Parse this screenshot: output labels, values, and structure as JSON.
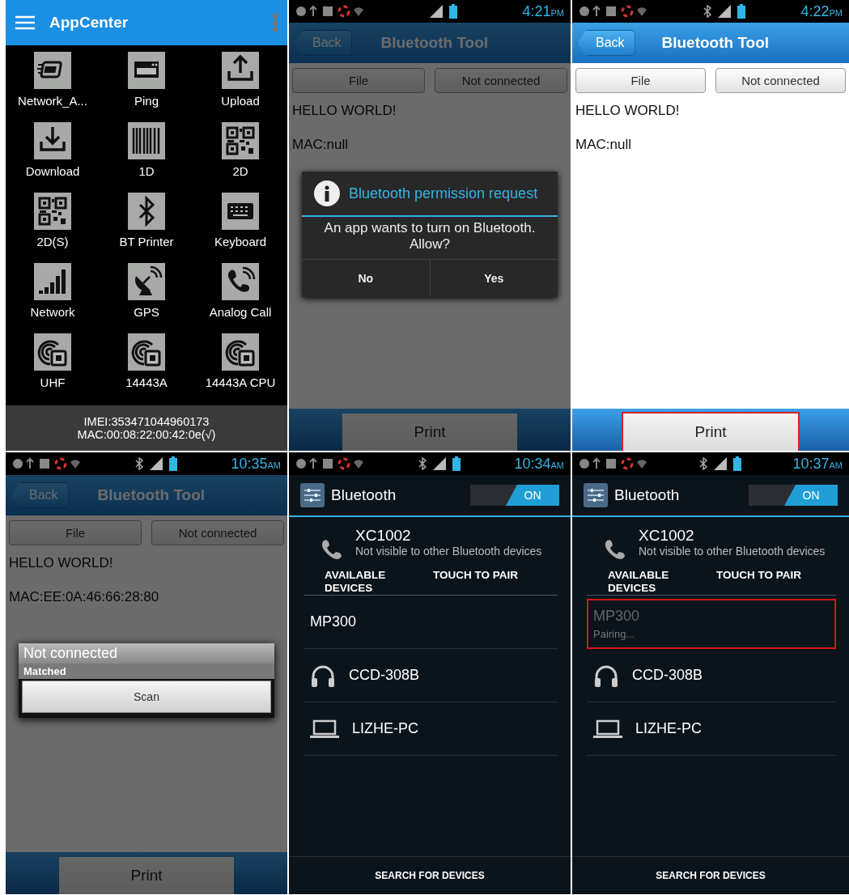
{
  "screens": [
    {
      "kind": "appcenter",
      "title": "AppCenter",
      "apps": [
        {
          "label": "Network_A...",
          "kind": "adapter"
        },
        {
          "label": "Ping",
          "kind": "window"
        },
        {
          "label": "Upload",
          "kind": "upload"
        },
        {
          "label": "Download",
          "kind": "download"
        },
        {
          "label": "1D",
          "kind": "barcode"
        },
        {
          "label": "2D",
          "kind": "qr"
        },
        {
          "label": "2D(S)",
          "kind": "qr"
        },
        {
          "label": "BT Printer",
          "kind": "bluetooth"
        },
        {
          "label": "Keyboard",
          "kind": "keyboard"
        },
        {
          "label": "Network",
          "kind": "signal"
        },
        {
          "label": "GPS",
          "kind": "dish"
        },
        {
          "label": "Analog Call",
          "kind": "call"
        },
        {
          "label": "UHF",
          "kind": "rfid"
        },
        {
          "label": "14443A",
          "kind": "rfid"
        },
        {
          "label": "14443A CPU",
          "kind": "rfid"
        }
      ],
      "footer": [
        "IMEI:353471044960173",
        "MAC:00:08:22:00:42:0e(√)"
      ]
    },
    {
      "kind": "tool",
      "status": {
        "time": "4:21",
        "period": "PM",
        "bluetooth": false
      },
      "back": "Back",
      "title": "Bluetooth Tool",
      "file": "File",
      "connection": "Not connected",
      "lines": [
        "HELLO WORLD!",
        "MAC:null"
      ],
      "print": {
        "label": "Print",
        "highlighted": false
      },
      "dialog": {
        "kind": "permission",
        "title": "Bluetooth permission request",
        "message": "An app wants to turn on Bluetooth. Allow?",
        "buttons": [
          "No",
          "Yes"
        ]
      }
    },
    {
      "kind": "tool",
      "status": {
        "time": "4:22",
        "period": "PM",
        "bluetooth": true
      },
      "back": "Back",
      "title": "Bluetooth Tool",
      "file": "File",
      "connection": "Not connected",
      "lines": [
        "HELLO WORLD!",
        "MAC:null"
      ],
      "print": {
        "label": "Print",
        "highlighted": true
      }
    },
    {
      "kind": "tool",
      "status": {
        "time": "10:35",
        "period": "AM",
        "bluetooth": true
      },
      "back": "Back",
      "title": "Bluetooth Tool",
      "file": "File",
      "connection": "Not connected",
      "lines": [
        "HELLO WORLD!",
        "MAC:EE:0A:46:66:28:80"
      ],
      "print": {
        "label": "Print",
        "highlighted": false
      },
      "dialog": {
        "kind": "menu",
        "title": "Not connected",
        "items": [
          "Matched"
        ],
        "button": "Scan"
      }
    },
    {
      "kind": "settings",
      "status": {
        "time": "10:34",
        "period": "AM",
        "bluetooth": true
      },
      "title": "Bluetooth",
      "toggle": {
        "label": "ON",
        "on": true
      },
      "device": {
        "name": "XC1002",
        "note": "Not visible to other Bluetooth devices"
      },
      "section": "AVAILABLE DEVICES",
      "hint": "TOUCH TO PAIR",
      "devices": [
        {
          "name": "MP300",
          "kind": "none",
          "highlighted": false,
          "disabled": false
        },
        {
          "name": "CCD-308B",
          "kind": "headphones",
          "highlighted": false,
          "disabled": false
        },
        {
          "name": "LIZHE-PC",
          "kind": "laptop",
          "highlighted": false,
          "disabled": false
        }
      ],
      "footer": "SEARCH FOR DEVICES"
    },
    {
      "kind": "settings",
      "status": {
        "time": "10:37",
        "period": "AM",
        "bluetooth": true
      },
      "title": "Bluetooth",
      "toggle": {
        "label": "ON",
        "on": true
      },
      "device": {
        "name": "XC1002",
        "note": "Not visible to other Bluetooth devices"
      },
      "section": "AVAILABLE DEVICES",
      "hint": "TOUCH TO PAIR",
      "devices": [
        {
          "name": "MP300",
          "kind": "none",
          "status": "Pairing...",
          "highlighted": true,
          "disabled": true
        },
        {
          "name": "CCD-308B",
          "kind": "headphones",
          "highlighted": false,
          "disabled": false
        },
        {
          "name": "LIZHE-PC",
          "kind": "laptop",
          "highlighted": false,
          "disabled": false
        }
      ],
      "footer": "SEARCH FOR DEVICES"
    }
  ]
}
